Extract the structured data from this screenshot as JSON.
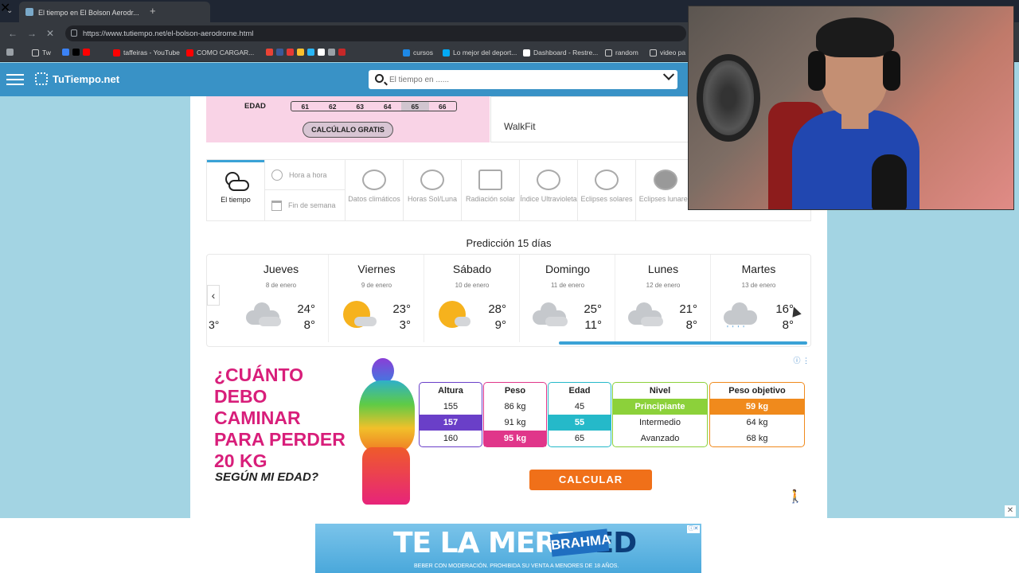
{
  "browser": {
    "tab_title": "El tiempo en El Bolson Aerodr...",
    "url": "https://www.tutiempo.net/el-bolson-aerodrome.html",
    "bookmarks": [
      "Tw",
      "taffeiras - YouTube",
      "COMO CARGAR...",
      "cursos",
      "Lo mejor del deport...",
      "Dashboard - Restre...",
      "random",
      "video pa"
    ]
  },
  "site": {
    "logo": "TuTiempo.net",
    "search_placeholder": "El tiempo en ......"
  },
  "promo": {
    "age_label": "EDAD",
    "ages": [
      "61",
      "62",
      "63",
      "64",
      "65",
      "66"
    ],
    "selected_age": "65",
    "button": "CALCÚLALO GRATIS",
    "brand": "WalkFit"
  },
  "nav": {
    "main": "El tiempo",
    "hour": "Hora a hora",
    "weekend": "Fin de semana",
    "tabs": [
      {
        "label": "Datos climáticos",
        "icon": "thermometer-icon"
      },
      {
        "label": "Horas Sol/Luna",
        "icon": "sun-moon-icon"
      },
      {
        "label": "Radiación solar",
        "icon": "solar-panel-icon"
      },
      {
        "label": "Índice Ultravioleta",
        "icon": "uv-icon"
      },
      {
        "label": "Eclipses solares",
        "icon": "solar-eclipse-icon"
      },
      {
        "label": "Eclipses lunares",
        "icon": "lunar-eclipse-icon"
      }
    ]
  },
  "forecast": {
    "title": "Predicción 15 días",
    "partial_low": "3°",
    "days": [
      {
        "name": "Jueves",
        "date": "8 de enero",
        "hi": "24°",
        "lo": "8°",
        "icon": "cloudy"
      },
      {
        "name": "Viernes",
        "date": "9 de enero",
        "hi": "23°",
        "lo": "3°",
        "icon": "sun-cloud"
      },
      {
        "name": "Sábado",
        "date": "10 de enero",
        "hi": "28°",
        "lo": "9°",
        "icon": "sun-cloud"
      },
      {
        "name": "Domingo",
        "date": "11 de enero",
        "hi": "25°",
        "lo": "11°",
        "icon": "cloudy"
      },
      {
        "name": "Lunes",
        "date": "12 de enero",
        "hi": "21°",
        "lo": "8°",
        "icon": "cloudy"
      },
      {
        "name": "Martes",
        "date": "13 de enero",
        "hi": "16°",
        "lo": "8°",
        "icon": "rain"
      }
    ]
  },
  "ad": {
    "headline": "¿CUÁNTO DEBO CAMINAR PARA PERDER 20 KG",
    "sub": "SEGÚN MI EDAD?",
    "cta": "CALCULAR",
    "columns": [
      {
        "header": "Altura",
        "values": [
          "155",
          "157",
          "160"
        ],
        "color": "#6a3fc8"
      },
      {
        "header": "Peso",
        "values": [
          "86 kg",
          "91 kg",
          "95 kg"
        ],
        "color": "#e0368a"
      },
      {
        "header": "Edad",
        "values": [
          "45",
          "55",
          "65"
        ],
        "color": "#25b9c9"
      },
      {
        "header": "Nivel",
        "values": [
          "Principiante",
          "Intermedio",
          "Avanzado"
        ],
        "color": "#8cd13a"
      },
      {
        "header": "Peso objetivo",
        "values": [
          "59 kg",
          "64 kg",
          "68 kg"
        ],
        "color": "#f08a1c"
      }
    ]
  },
  "bottom_ad": {
    "text_a": "TE LA MERE",
    "text_b": "SED",
    "brand": "BRAHMA",
    "disclaimer": "BEBER CON MODERACIÓN. PROHIBIDA SU VENTA A MENORES DE 18 AÑOS."
  }
}
